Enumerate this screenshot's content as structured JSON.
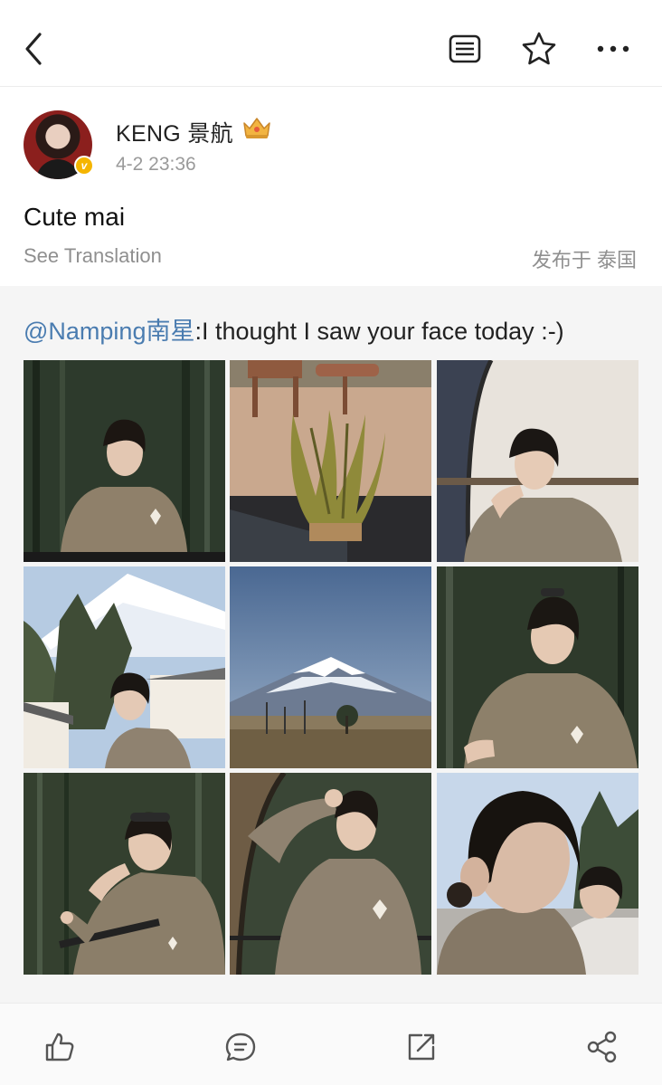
{
  "post": {
    "author_name": "KENG 景航",
    "time": "4-2 23:36",
    "text": "Cute mai",
    "translate_label": "See Translation",
    "location": "发布于 泰国"
  },
  "repost": {
    "mention": "@Namping南星",
    "text": ":I thought I saw your face today :-)"
  },
  "photos": [
    {
      "subject": "man in beige sweater, forest"
    },
    {
      "subject": "dried plant on wooden deck"
    },
    {
      "subject": "man seated by window"
    },
    {
      "subject": "man below snowy Mount Fuji"
    },
    {
      "subject": "Mount Fuji landscape"
    },
    {
      "subject": "man in sweater, profile"
    },
    {
      "subject": "man leaning on railing"
    },
    {
      "subject": "man with hand raised"
    },
    {
      "subject": "close-up side view"
    }
  ],
  "icons": {
    "back": "chevron-left-icon",
    "reader": "reader-mode-icon",
    "favorite": "star-icon",
    "more": "more-dots-icon",
    "like": "thumbs-up-icon",
    "comment": "comment-icon",
    "repost": "repost-icon",
    "share": "share-icon"
  },
  "colors": {
    "mention": "#4a7cb0",
    "verified_badge": "#f5b500",
    "repost_bg": "#f5f5f5"
  }
}
